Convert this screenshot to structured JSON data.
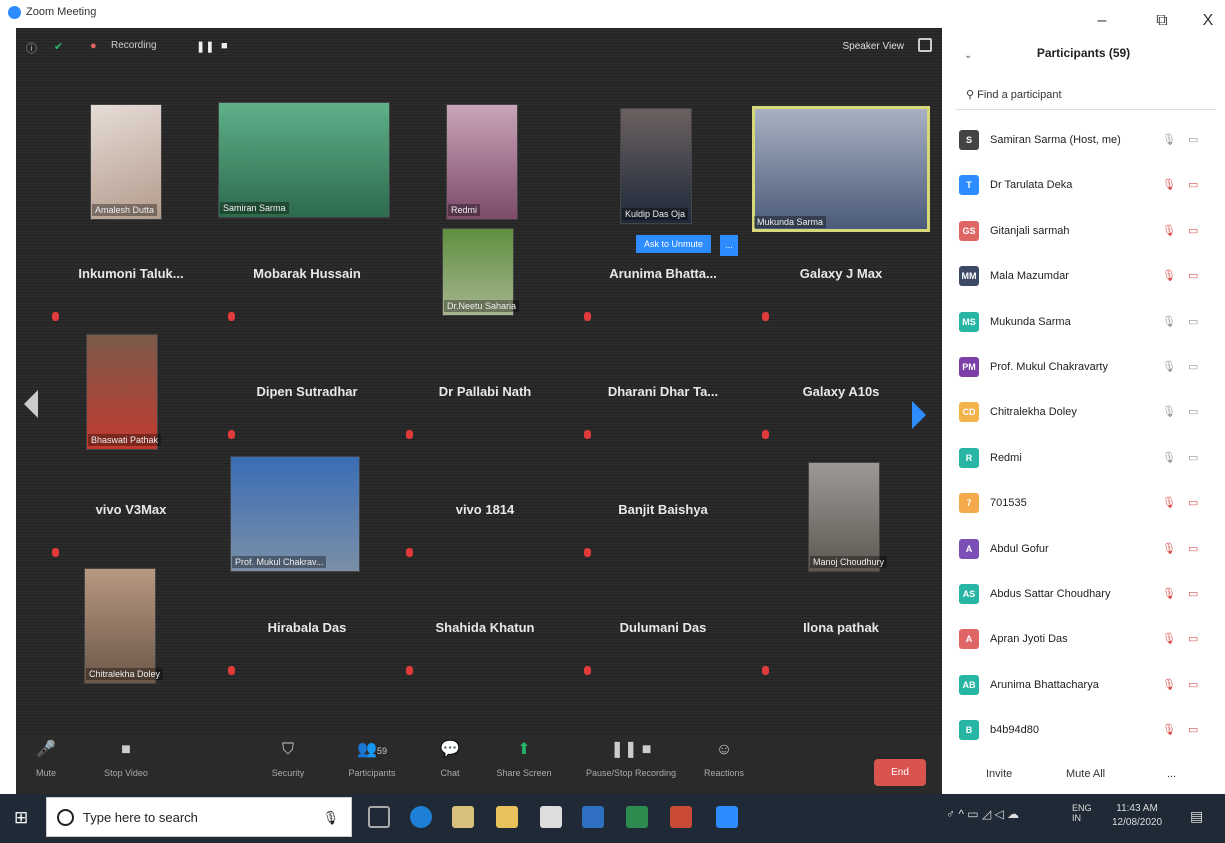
{
  "window": {
    "title": "Zoom Meeting",
    "minimize": "–",
    "restore": "⧉",
    "close": "X"
  },
  "topbar": {
    "recording": "Recording",
    "speaker_view": "Speaker View"
  },
  "tiles": [
    {
      "label": "Amalesh Dutta",
      "video": true
    },
    {
      "label": "Samiran Sarma",
      "video": true
    },
    {
      "label": "Redmi",
      "video": true
    },
    {
      "label": "Kuldip Das Oja",
      "video": true
    },
    {
      "label": "Mukunda Sarma",
      "video": true
    },
    {
      "name": "Inkumoni Taluk..."
    },
    {
      "name": "Mobarak Hussain"
    },
    {
      "label": "Dr.Neetu Saharia",
      "video": true
    },
    {
      "name": "Arunima Bhatta..."
    },
    {
      "name": "Galaxy J Max"
    },
    {
      "label": "Bhaswati Pathak",
      "video": true
    },
    {
      "name": "Dipen Sutradhar"
    },
    {
      "name": "Dr Pallabi Nath"
    },
    {
      "name": "Dharani Dhar Ta..."
    },
    {
      "name": "Galaxy A10s"
    },
    {
      "name": "vivo V3Max"
    },
    {
      "label": "Prof. Mukul Chakrav...",
      "video": true
    },
    {
      "name": "vivo 1814"
    },
    {
      "name": "Banjit Baishya"
    },
    {
      "label": "Manoj Choudhury",
      "video": true
    },
    {
      "label": "Chitralekha Doley",
      "video": true
    },
    {
      "name": "Hirabala Das"
    },
    {
      "name": "Shahida Khatun"
    },
    {
      "name": "Dulumani Das"
    },
    {
      "name": "Ilona pathak"
    }
  ],
  "ask_to_unmute": "Ask to Unmute",
  "ask_more": "...",
  "toolbar": {
    "mute": "Mute",
    "stop_video": "Stop Video",
    "security": "Security",
    "participants": "Participants",
    "participants_count": "59",
    "chat": "Chat",
    "share": "Share Screen",
    "record": "Pause/Stop Recording",
    "reactions": "Reactions",
    "end": "End"
  },
  "panel": {
    "title": "Participants (59)",
    "find_placeholder": "Find a participant",
    "invite": "Invite",
    "mute_all": "Mute All",
    "more": "...",
    "participants": [
      {
        "initials": "S",
        "name": "Samiran Sarma (Host, me)",
        "color": "#444"
      },
      {
        "initials": "T",
        "name": "Dr Tarulata Deka",
        "color": "#2d8cff"
      },
      {
        "initials": "GS",
        "name": "Gitanjali sarmah",
        "color": "#e06666"
      },
      {
        "initials": "MM",
        "name": "Mala Mazumdar",
        "color": "#3c4a66"
      },
      {
        "initials": "MS",
        "name": "Mukunda Sarma",
        "color": "#27b5a4"
      },
      {
        "initials": "PM",
        "name": "Prof. Mukul Chakravarty",
        "color": "#7c3fa8"
      },
      {
        "initials": "CD",
        "name": "Chitralekha Doley",
        "color": "#f4b24a"
      },
      {
        "initials": "R",
        "name": "Redmi",
        "color": "#27b5a4"
      },
      {
        "initials": "7",
        "name": "701535",
        "color": "#f4a94a"
      },
      {
        "initials": "A",
        "name": "Abdul Gofur",
        "color": "#7c4fb8"
      },
      {
        "initials": "AS",
        "name": "Abdus Sattar Choudhary",
        "color": "#27b5a4"
      },
      {
        "initials": "A",
        "name": "Apran Jyoti Das",
        "color": "#e06666"
      },
      {
        "initials": "AB",
        "name": "Arunima Bhattacharya",
        "color": "#27b5a4"
      },
      {
        "initials": "B",
        "name": "b4b94d80",
        "color": "#27b5a4"
      }
    ]
  },
  "taskbar": {
    "search_placeholder": "Type here to search",
    "lang1": "ENG",
    "lang2": "IN",
    "time": "11:43 AM",
    "date": "12/08/2020"
  }
}
